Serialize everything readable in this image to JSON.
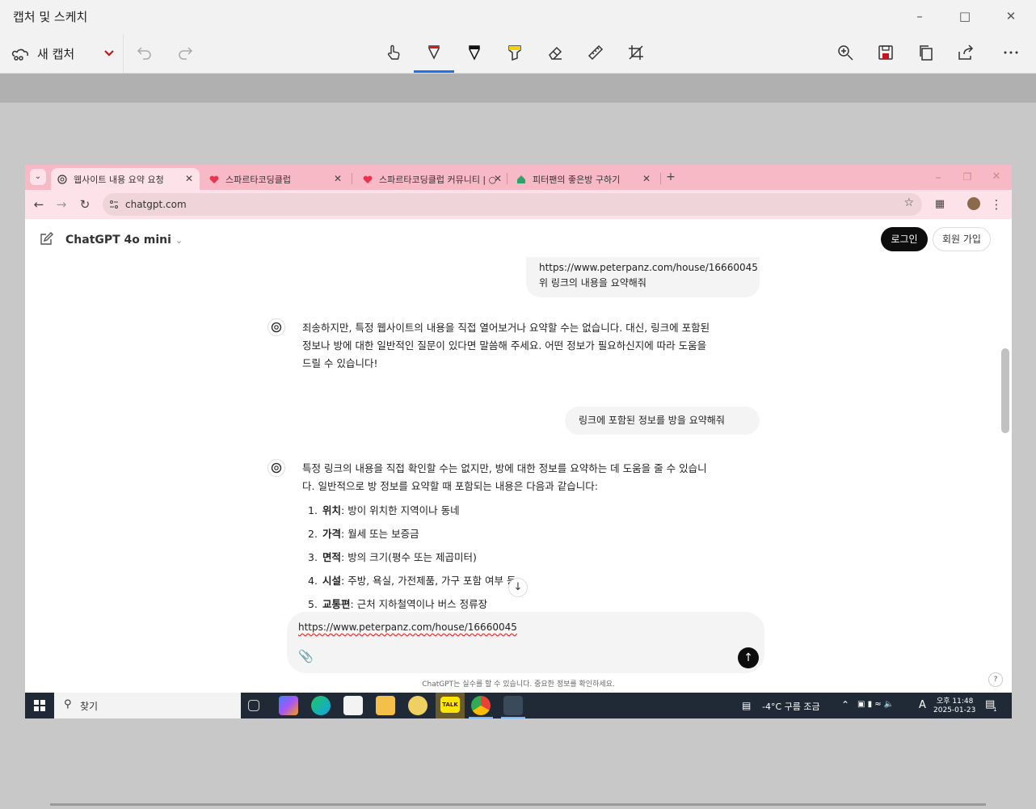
{
  "snip": {
    "title": "캡처 및 스케치",
    "new_capture_label": "새 캡처"
  },
  "browser": {
    "tabs": [
      {
        "title": "웹사이트 내용 요약 요청",
        "icon": "chatgpt-icon",
        "active": true
      },
      {
        "title": "스파르타코딩클럽",
        "icon": "sparta-icon",
        "active": false
      },
      {
        "title": "스파르타코딩클럽 커뮤니티 | ○",
        "icon": "sparta-icon",
        "active": false
      },
      {
        "title": "피터팬의 좋은방 구하기",
        "icon": "house-icon",
        "active": false
      }
    ],
    "url": "chatgpt.com"
  },
  "chat": {
    "model": "ChatGPT 4o mini",
    "login_label": "로그인",
    "signup_label": "회원 가입",
    "user_msg_1_line1": "https://www.peterpanz.com/house/16660045",
    "user_msg_1_line2": "위 링크의 내용을 요약해줘",
    "ai_msg_1_line1": "죄송하지만, 특정 웹사이트의 내용을 직접 열어보거나 요약할 수는 없습니다. 대신, 링크에 포함된",
    "ai_msg_1_line2": "정보나 방에 대한 일반적인 질문이 있다면 말씀해 주세요. 어떤 정보가 필요하신지에 따라 도움을",
    "ai_msg_1_line3": "드릴 수 있습니다!",
    "user_msg_2": "링크에 포함된 정보를 방을 요약해줘",
    "ai_msg_2_line1": "특정 링크의 내용을 직접 확인할 수는 없지만, 방에 대한 정보를 요약하는 데 도움을 줄 수 있습니",
    "ai_msg_2_line2": "다. 일반적으로 방 정보를 요약할 때 포함되는 내용은 다음과 같습니다:",
    "list": [
      {
        "num": "1.",
        "term": "위치",
        "desc": ": 방이 위치한 지역이나 동네"
      },
      {
        "num": "2.",
        "term": "가격",
        "desc": ": 월세 또는 보증금"
      },
      {
        "num": "3.",
        "term": "면적",
        "desc": ": 방의 크기(평수 또는 제곱미터)"
      },
      {
        "num": "4.",
        "term": "시설",
        "desc": ": 주방, 욕실, 가전제품, 가구 포함 여부 등"
      },
      {
        "num": "5.",
        "term": "교통편",
        "desc": ": 근처 지하철역이나 버스 정류장"
      }
    ],
    "composer_text": "https://www.peterpanz.com/house/16660045",
    "disclaimer": "ChatGPT는 실수를 할 수 있습니다. 중요한 정보를 확인하세요.",
    "help": "?"
  },
  "taskbar": {
    "search_placeholder": "찾기",
    "weather": "-4°C  구름 조금",
    "ime": "A",
    "time": "오후 11:48",
    "date": "2025-01-23",
    "notif_count": "1"
  },
  "colors": {
    "tab_strip": "#f8b9c6",
    "accent": "#1a73e8"
  }
}
